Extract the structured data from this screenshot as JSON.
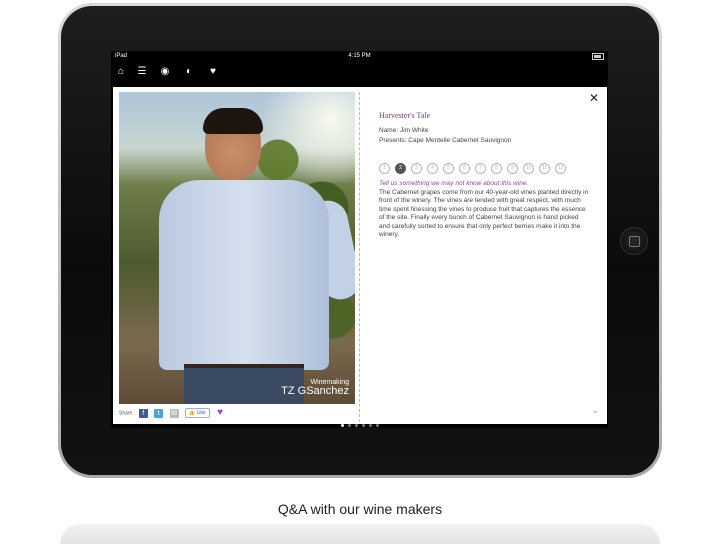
{
  "status_bar": {
    "carrier": "iPad",
    "time": "4:15 PM"
  },
  "nav_icons": [
    "home-icon",
    "list-icon",
    "map-pin-icon",
    "vineyard-icon",
    "heart-icon"
  ],
  "photo": {
    "caption_line1": "Winemaking",
    "caption_line2": "TZ GSanchez"
  },
  "share": {
    "label": "Share",
    "like_label": "Like"
  },
  "article": {
    "title": "Harvester's Tale",
    "name": "Name: Jim White",
    "presents": "Presents: Cape Mentelle Cabernet Sauvignon",
    "pages": [
      "1",
      "2",
      "3",
      "4",
      "5",
      "6",
      "7",
      "8",
      "9",
      "10",
      "11",
      "12"
    ],
    "active_page": "2",
    "question": "Tell us something we may not know about this wine.",
    "answer": "The Cabernet grapes come from our 40-year-old vines planted directly in front of the winery. The vines are tended with great respect, with much time spent finessing the vines to produce fruit that captures the essence of the site. Finally every bunch of Cabernet Sauvignon is hand picked and carefully sorted to ensure that only perfect berries make it into the winery."
  },
  "caption": "Q&A with our wine makers"
}
